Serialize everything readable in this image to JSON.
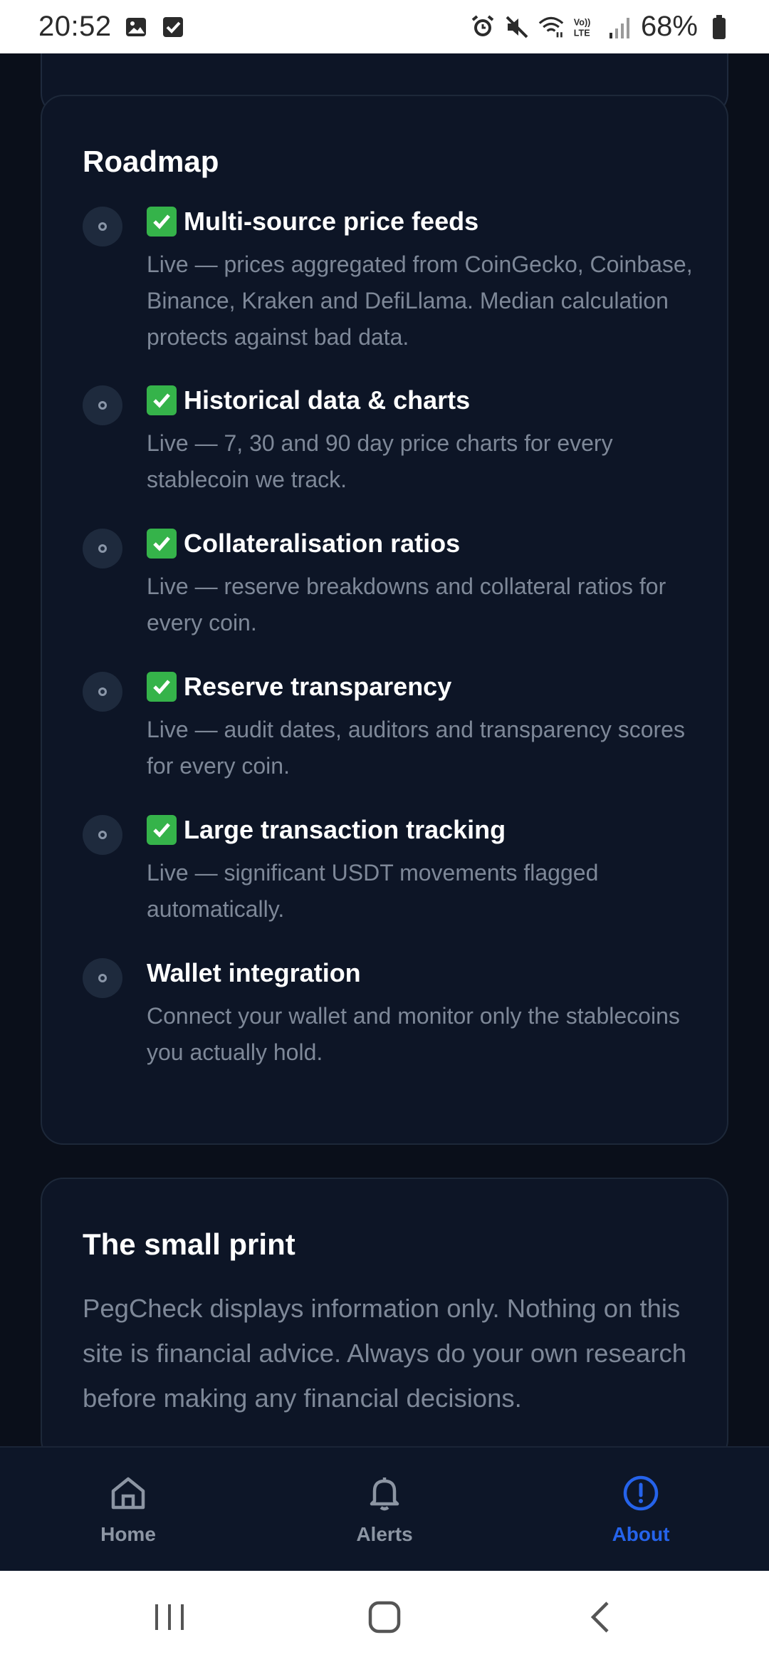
{
  "status_bar": {
    "time": "20:52",
    "battery": "68%",
    "icons": [
      "image-icon",
      "checkbox-icon",
      "alarm-icon",
      "mute-icon",
      "wifi-icon",
      "volte-icon",
      "signal-icon",
      "battery-icon"
    ],
    "volte_label": "Vo))\nLTE"
  },
  "roadmap": {
    "title": "Roadmap",
    "items": [
      {
        "checked": true,
        "title": "Multi-source price feeds",
        "description": "Live — prices aggregated from CoinGecko, Coinbase, Binance, Kraken and DefiLlama. Median calculation protects against bad data."
      },
      {
        "checked": true,
        "title": "Historical data & charts",
        "description": "Live — 7, 30 and 90 day price charts for every stablecoin we track."
      },
      {
        "checked": true,
        "title": "Collateralisation ratios",
        "description": "Live — reserve breakdowns and collateral ratios for every coin."
      },
      {
        "checked": true,
        "title": "Reserve transparency",
        "description": "Live — audit dates, auditors and transparency scores for every coin."
      },
      {
        "checked": true,
        "title": "Large transaction tracking",
        "description": "Live — significant USDT movements flagged automatically."
      },
      {
        "checked": false,
        "title": "Wallet integration",
        "description": "Connect your wallet and monitor only the stablecoins you actually hold."
      }
    ]
  },
  "small_print": {
    "title": "The small print",
    "text": "PegCheck displays information only. Nothing on this site is financial advice. Always do your own research before making any financial decisions."
  },
  "bottom_nav": {
    "items": [
      {
        "label": "Home",
        "icon": "home-icon",
        "active": false
      },
      {
        "label": "Alerts",
        "icon": "bell-icon",
        "active": false
      },
      {
        "label": "About",
        "icon": "info-icon",
        "active": true
      }
    ]
  },
  "colors": {
    "background": "#0a0f1a",
    "card": "#0d1526",
    "accent": "#2563eb",
    "check": "#35b34a",
    "muted_text": "#7e8898"
  }
}
